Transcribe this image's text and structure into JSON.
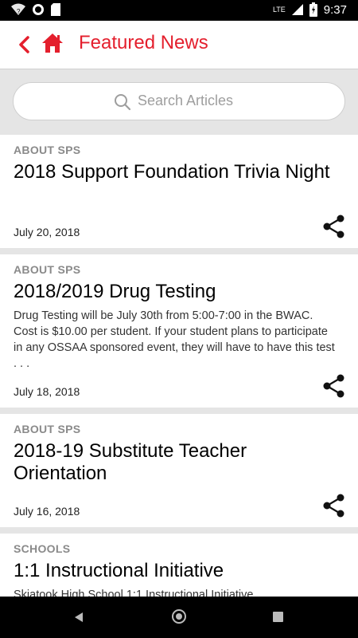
{
  "status_bar": {
    "network": "LTE",
    "time": "9:37"
  },
  "app_bar": {
    "title": "Featured News"
  },
  "search": {
    "placeholder": "Search Articles"
  },
  "articles": [
    {
      "category": "ABOUT SPS",
      "title": "2018 Support Foundation Trivia Night",
      "description": "",
      "date": "July 20, 2018"
    },
    {
      "category": "ABOUT SPS",
      "title": "2018/2019 Drug Testing",
      "description": "Drug Testing will be July 30th from 5:00-7:00 in the BWAC. Cost is $10.00 per student. If your student plans to participate in any OSSAA sponsored event, they will have to have this test . . .",
      "date": "July 18, 2018"
    },
    {
      "category": "ABOUT SPS",
      "title": "2018-19 Substitute Teacher Orientation",
      "description": "",
      "date": "July 16, 2018"
    },
    {
      "category": "SCHOOLS",
      "title": "1:1 Instructional Initiative",
      "description": "Skiatook High School 1:1 Instructional Initiative",
      "date": ""
    }
  ],
  "colors": {
    "accent": "#e41f2d"
  },
  "icons": {
    "back": "chevron-left-icon",
    "home": "home-icon",
    "search": "search-icon",
    "share": "share-icon"
  }
}
